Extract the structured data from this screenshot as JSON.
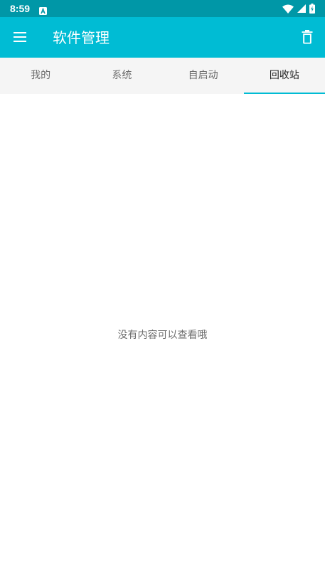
{
  "status_bar": {
    "time": "8:59",
    "background_color": "#0097a7",
    "notification_icon": "a-letter-icon",
    "icons": [
      "wifi-icon",
      "signal-icon",
      "battery-charging-icon"
    ]
  },
  "app_bar": {
    "title": "软件管理",
    "background_color": "#00bcd4",
    "menu_icon": "hamburger-menu-icon",
    "action_icon": "trash-icon"
  },
  "tabs": [
    {
      "label": "我的",
      "active": false
    },
    {
      "label": "系统",
      "active": false
    },
    {
      "label": "自启动",
      "active": false
    },
    {
      "label": "回收站",
      "active": true
    }
  ],
  "content": {
    "empty_message": "没有内容可以查看哦"
  }
}
